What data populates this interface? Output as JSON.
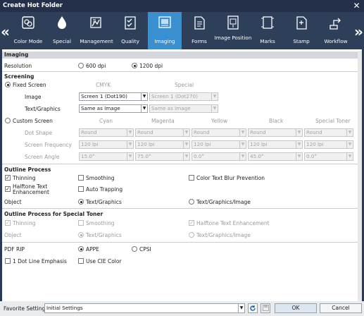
{
  "window": {
    "title": "Create Hot Folder"
  },
  "toolbar": {
    "items": [
      {
        "label": "Color Mode",
        "icon": "color-mode-icon"
      },
      {
        "label": "Special",
        "icon": "drop-icon"
      },
      {
        "label": "Management",
        "icon": "management-icon"
      },
      {
        "label": "Quality",
        "icon": "quality-icon"
      },
      {
        "label": "Imaging",
        "icon": "imaging-icon"
      },
      {
        "label": "Forms",
        "icon": "forms-icon"
      },
      {
        "label": "Image Position",
        "icon": "image-position-icon"
      },
      {
        "label": "Marks",
        "icon": "marks-icon"
      },
      {
        "label": "Stamp",
        "icon": "stamp-icon"
      },
      {
        "label": "Workflow",
        "icon": "workflow-icon"
      }
    ],
    "prev_arrow": "«",
    "next_arrow": "»",
    "active_color": "#3a8fd0"
  },
  "imaging": {
    "section_title": "Imaging",
    "resolution": {
      "label": "Resolution",
      "option1": "600 dpi",
      "option2": "1200 dpi"
    },
    "screening": {
      "title": "Screening",
      "fixed_label": "Fixed Screen",
      "col_cmyk": "CMYK",
      "col_special": "Special",
      "image_label": "Image",
      "image_cmyk": "Screen 1 (Dot190)",
      "image_special": "Screen 1 (Dot270)",
      "textgraphics_label": "Text/Graphics",
      "tg_cmyk": "Same as Image",
      "tg_special": "Same as Image",
      "custom_label": "Custom Screen",
      "columns": [
        "Cyan",
        "Magenta",
        "Yellow",
        "Black",
        "Special Toner"
      ],
      "dot_shape_label": "Dot Shape",
      "dot_shape_values": [
        "Round",
        "Round",
        "Round",
        "Round",
        "Round"
      ],
      "freq_label": "Screen Frequency",
      "freq_values": [
        "120 lpi",
        "120 lpi",
        "120 lpi",
        "120 lpi",
        "120 lpi"
      ],
      "angle_label": "Screen Angle",
      "angle_values": [
        "15.0°",
        "75.0°",
        "0.0°",
        "45.0°",
        "0.0°"
      ]
    },
    "outline": {
      "title": "Outline Process",
      "thinning": "Thinning",
      "smoothing": "Smoothing",
      "color_text_blur": "Color Text Blur Prevention",
      "halftone_line1": "Halftone Text",
      "halftone_line2": "Enhancement",
      "auto_trapping": "Auto Trapping",
      "object_label": "Object",
      "obj_opt1": "Text/Graphics",
      "obj_opt2": "Text/Graphics/Image"
    },
    "outline_special": {
      "title": "Outline Process for Special Toner",
      "thinning": "Thinning",
      "smoothing": "Smoothing",
      "halftone": "Halftone Text Enhancement",
      "object_label": "Object",
      "obj_opt1": "Text/Graphics",
      "obj_opt2": "Text/Graphics/Image"
    },
    "pdf": {
      "label": "PDF RIP",
      "opt1": "APPE",
      "opt2": "CPSI",
      "dot_line": "1 Dot Line Emphasis",
      "cie": "Use CIE Color"
    }
  },
  "footer": {
    "favorite_label": "Favorite Setting",
    "favorite_value": "Initial Settings",
    "ok": "OK",
    "cancel": "Cancel"
  }
}
